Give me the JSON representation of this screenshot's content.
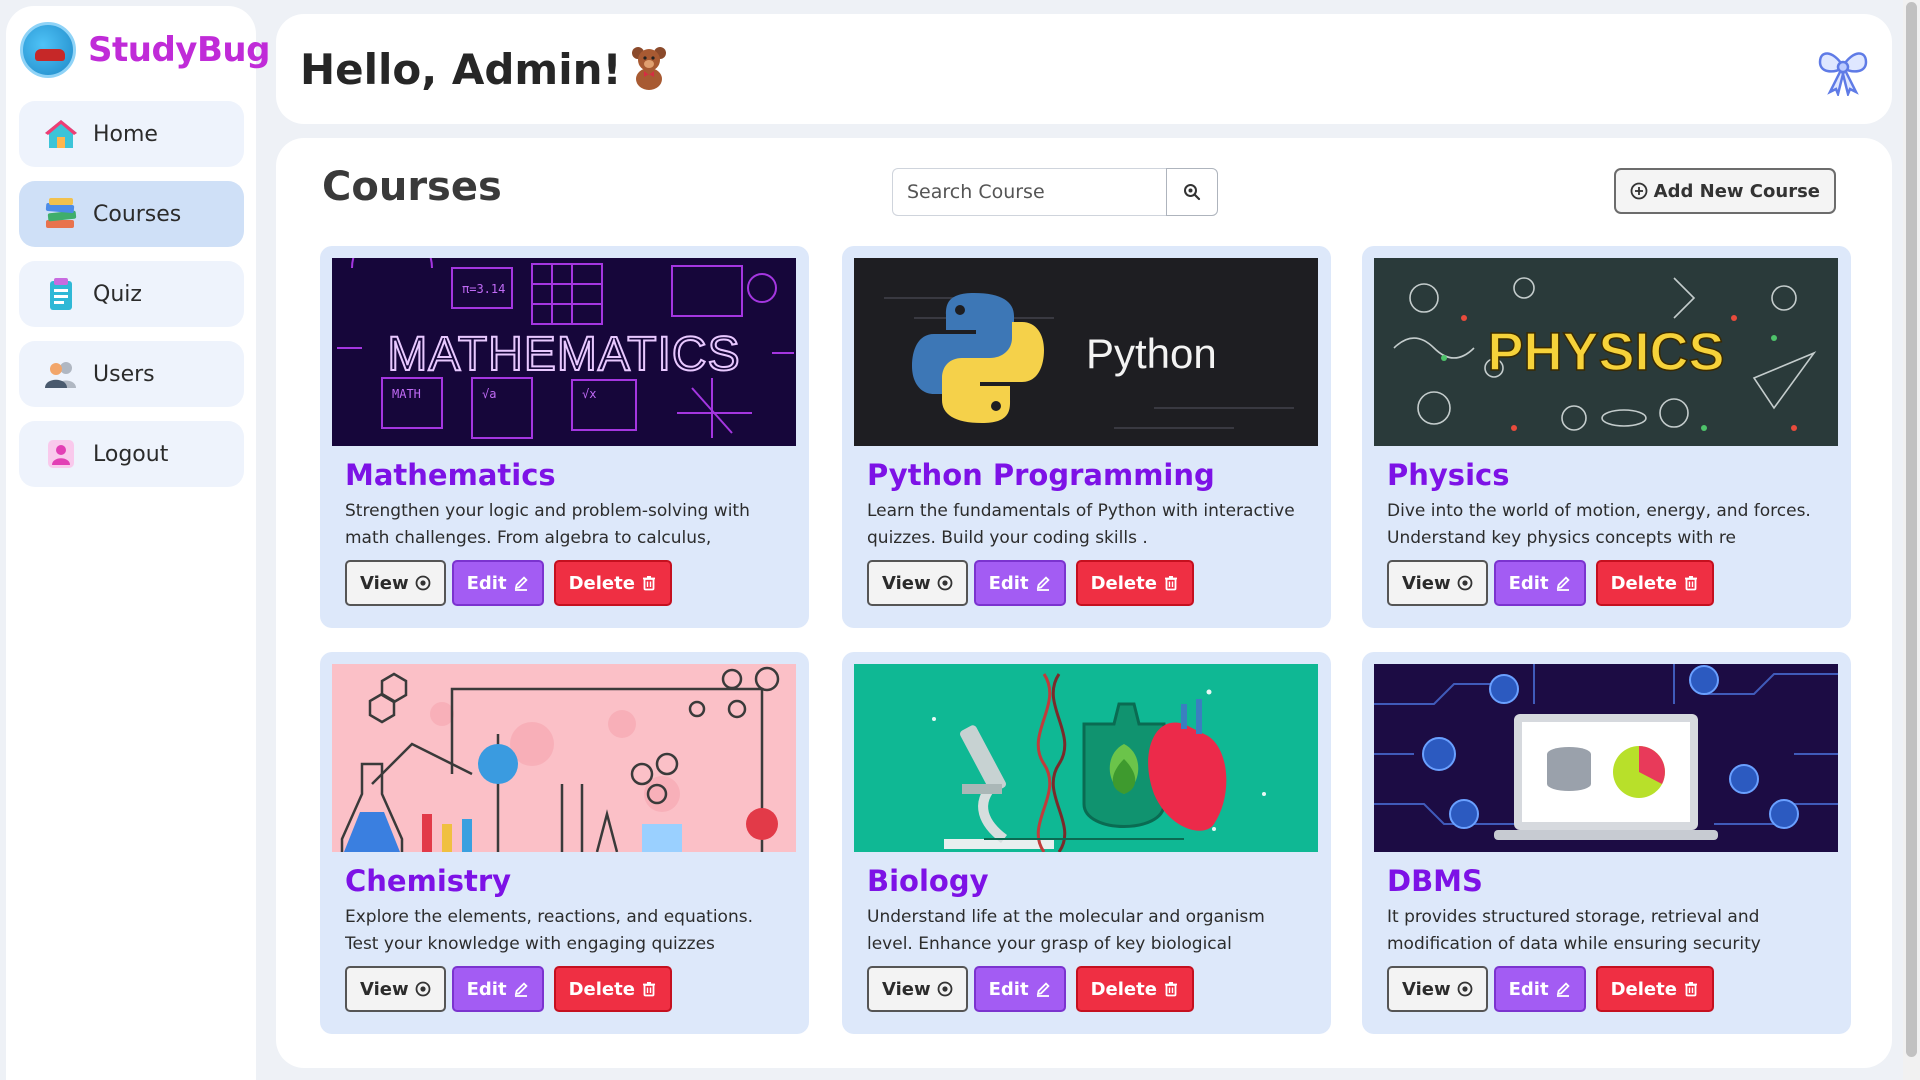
{
  "brand": {
    "name": "StudyBug"
  },
  "nav": {
    "items": [
      {
        "label": "Home",
        "icon": "home-icon"
      },
      {
        "label": "Courses",
        "icon": "books-icon",
        "active": true
      },
      {
        "label": "Quiz",
        "icon": "clipboard-icon"
      },
      {
        "label": "Users",
        "icon": "users-icon"
      },
      {
        "label": "Logout",
        "icon": "logout-icon"
      }
    ]
  },
  "header": {
    "greeting": "Hello, Admin!",
    "greeting_icon": "teddy-bear-icon",
    "right_icon": "ribbon-bow-icon"
  },
  "main": {
    "title": "Courses",
    "search": {
      "placeholder": "Search Course",
      "value": ""
    },
    "add_button": "Add New Course"
  },
  "courses": [
    {
      "title": "Mathematics",
      "description": "Strengthen your logic and problem-solving with math challenges. From algebra to calculus,",
      "image_text": "MATHEMATICS"
    },
    {
      "title": "Python Programming",
      "description": "Learn the fundamentals of Python with interactive quizzes. Build your coding skills .",
      "image_text": "Python"
    },
    {
      "title": "Physics",
      "description": "Dive into the world of motion, energy, and forces. Understand key physics concepts with re",
      "image_text": "PHYSICS"
    },
    {
      "title": "Chemistry",
      "description": "Explore the elements, reactions, and equations. Test your knowledge with engaging quizzes"
    },
    {
      "title": "Biology",
      "description": "Understand life at the molecular and organism level. Enhance your grasp of key biological"
    },
    {
      "title": "DBMS",
      "description": "It provides structured storage, retrieval and modification of data while ensuring security"
    }
  ],
  "card_buttons": {
    "view": "View",
    "edit": "Edit",
    "delete": "Delete"
  },
  "colors": {
    "brand": "#c02bd8",
    "course_title": "#7d12e6",
    "edit_button": "#a35cf3",
    "delete_button": "#ef2f43",
    "card_background": "#dde8fa"
  }
}
